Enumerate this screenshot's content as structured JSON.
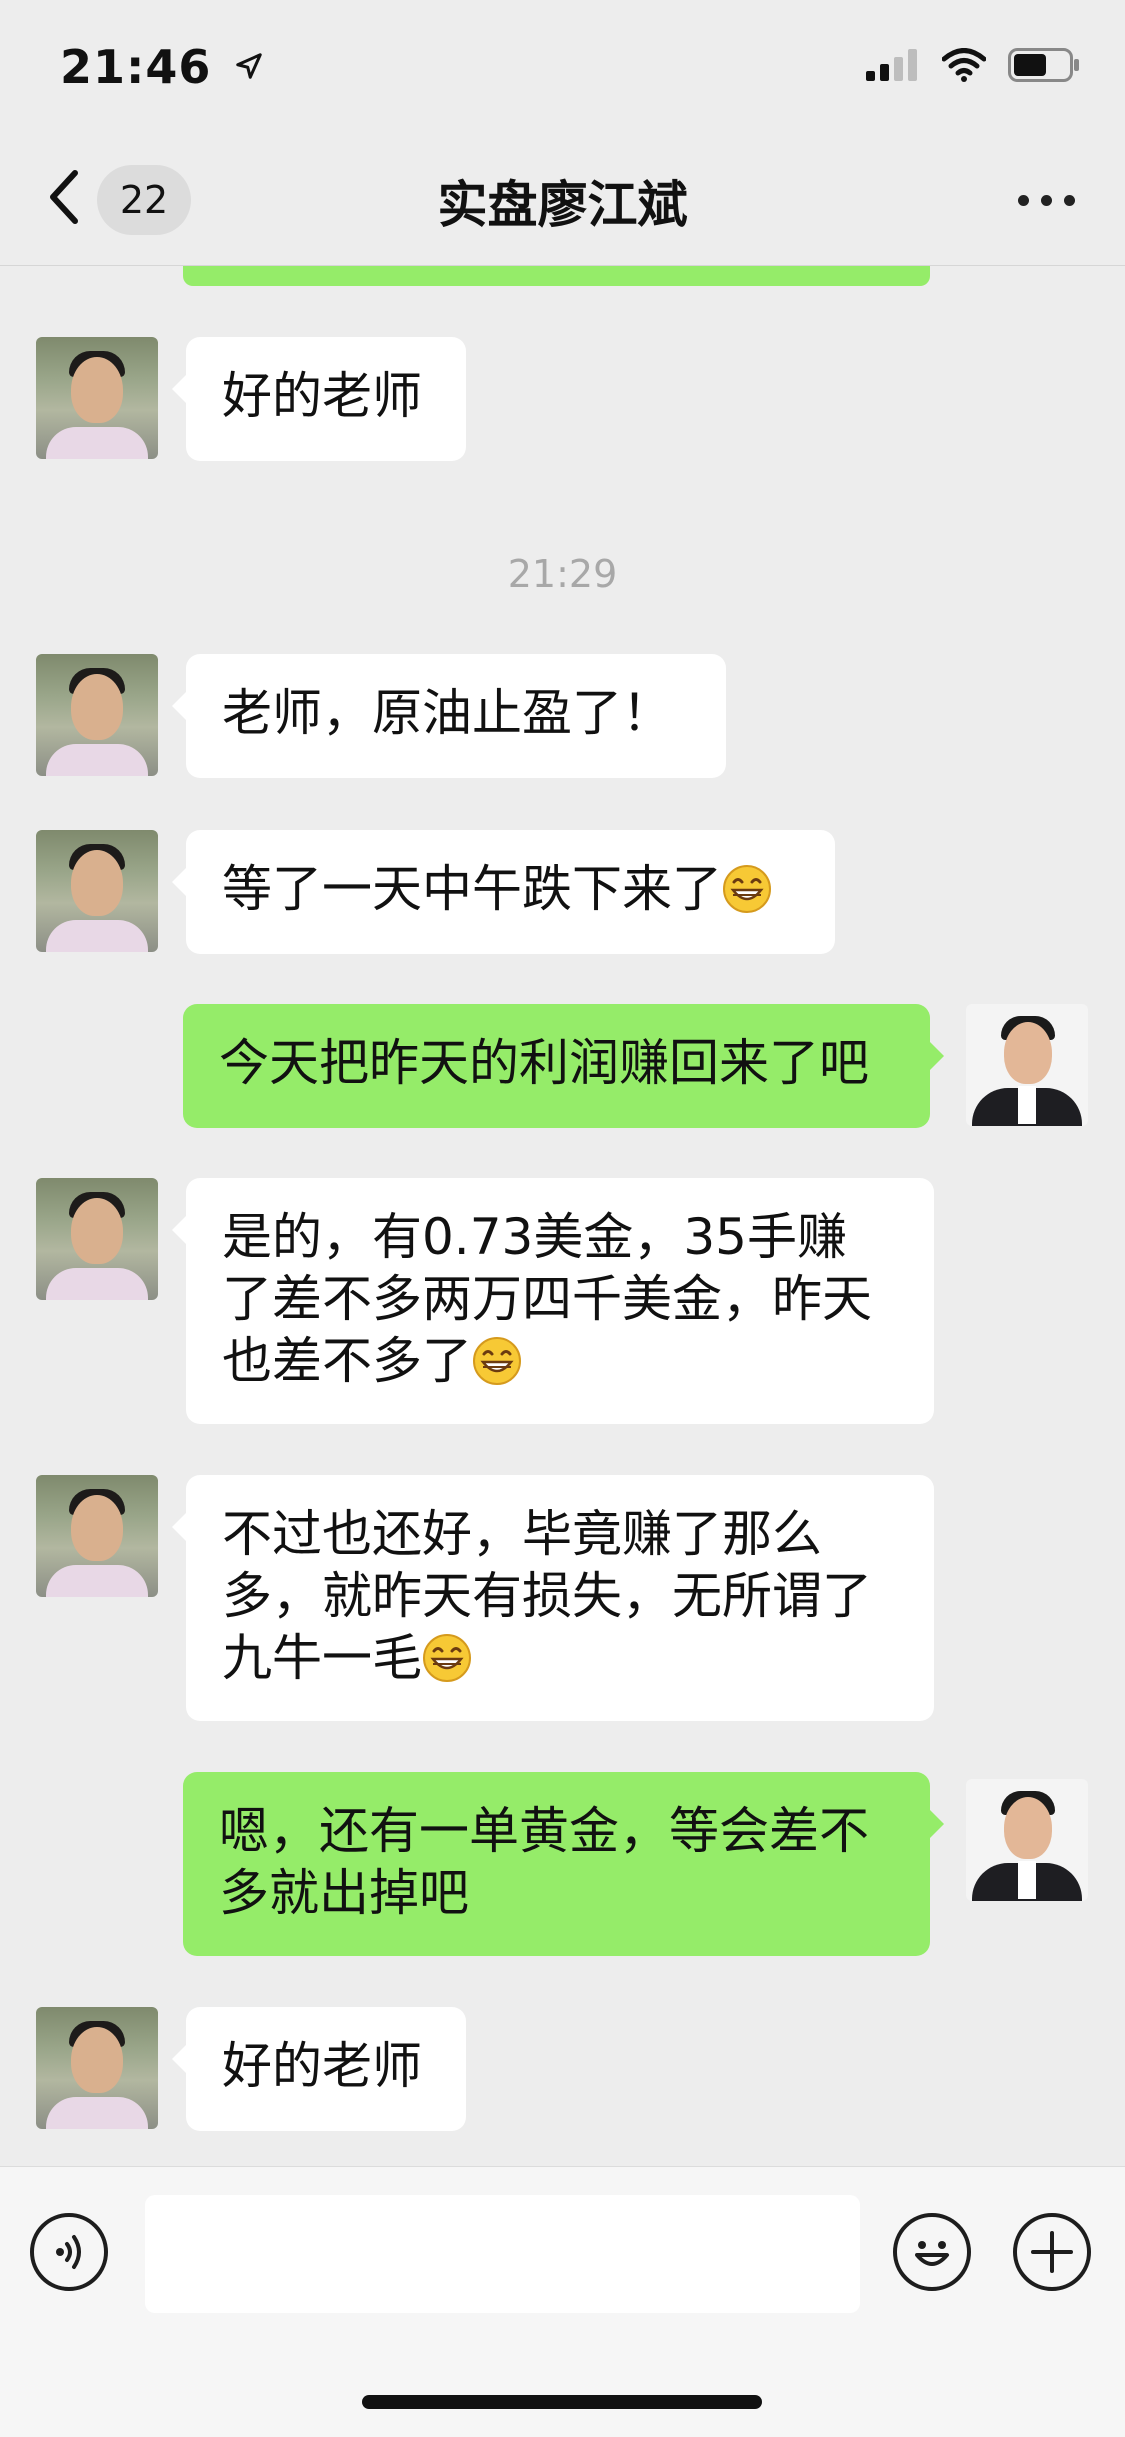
{
  "status": {
    "time": "21:46"
  },
  "nav": {
    "unread_count": "22",
    "title": "实盘廖江斌"
  },
  "messages": [
    {
      "side": "left",
      "text": "好的老师"
    },
    {
      "side": "time",
      "text": "21:29"
    },
    {
      "side": "left",
      "text": "老师，原油止盈了！"
    },
    {
      "side": "left",
      "text": "等了一天中午跌下来了",
      "emoji": "grin"
    },
    {
      "side": "right",
      "text": "今天把昨天的利润赚回来了吧"
    },
    {
      "side": "left",
      "lines": [
        "是的，有0.73美金，35手赚",
        "了差不多两万四千美金，昨天",
        "也差不多了"
      ],
      "emoji": "grin"
    },
    {
      "side": "left",
      "lines": [
        "不过也还好，毕竟赚了那么",
        "多，就昨天有损失，无所谓了",
        "九牛一毛"
      ],
      "emoji": "grin"
    },
    {
      "side": "right",
      "lines": [
        "嗯，还有一单黄金，等会差不",
        "多就出掉吧"
      ]
    },
    {
      "side": "left",
      "text": "好的老师"
    }
  ],
  "colors": {
    "self_bubble": "#95ec69",
    "other_bubble": "#ffffff",
    "background": "#ededed"
  },
  "icons": [
    "back-chevron-icon",
    "more-icon",
    "voice-icon",
    "emoji-icon",
    "plus-icon",
    "signal-icon",
    "wifi-icon",
    "battery-icon",
    "location-arrow-icon"
  ]
}
